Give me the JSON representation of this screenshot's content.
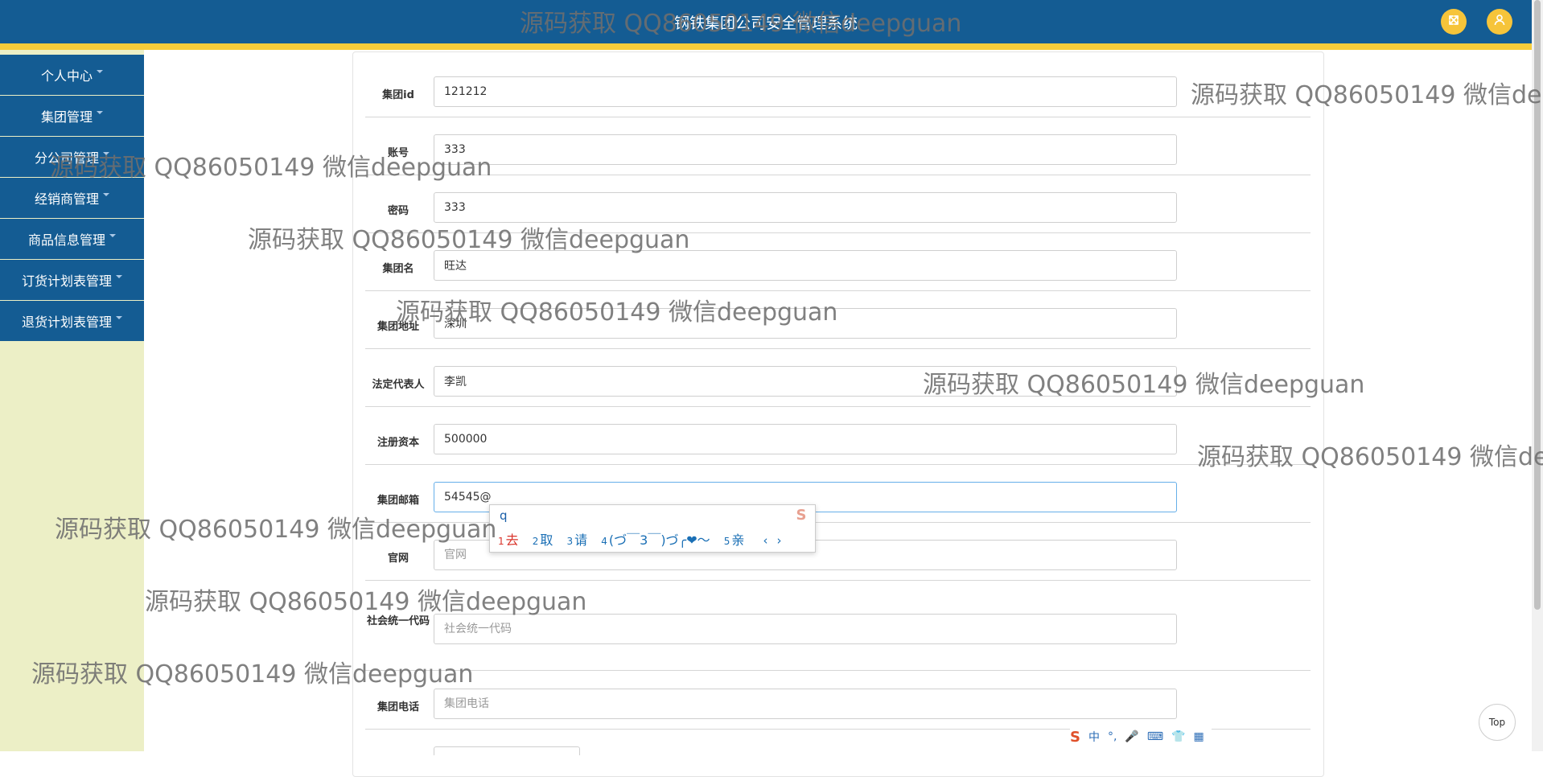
{
  "header": {
    "title": "钢铁集团公司安全管理系统"
  },
  "sidebar": {
    "items": [
      {
        "label": "个人中心"
      },
      {
        "label": "集团管理"
      },
      {
        "label": "分公司管理"
      },
      {
        "label": "经销商管理"
      },
      {
        "label": "商品信息管理"
      },
      {
        "label": "订货计划表管理"
      },
      {
        "label": "退货计划表管理"
      }
    ]
  },
  "form": {
    "fields": [
      {
        "label": "集团id",
        "value": "121212",
        "placeholder": ""
      },
      {
        "label": "账号",
        "value": "333",
        "placeholder": ""
      },
      {
        "label": "密码",
        "value": "333",
        "placeholder": ""
      },
      {
        "label": "集团名",
        "value": "旺达",
        "placeholder": ""
      },
      {
        "label": "集团地址",
        "value": "深圳",
        "placeholder": ""
      },
      {
        "label": "法定代表人",
        "value": "李凯",
        "placeholder": ""
      },
      {
        "label": "注册资本",
        "value": "500000",
        "placeholder": ""
      },
      {
        "label": "集团邮箱",
        "value": "54545@",
        "placeholder": ""
      },
      {
        "label": "官网",
        "value": "",
        "placeholder": "官网"
      },
      {
        "label": "社会统一代码",
        "value": "",
        "placeholder": "社会统一代码"
      },
      {
        "label": "集团电话",
        "value": "",
        "placeholder": "集团电话"
      }
    ]
  },
  "ime": {
    "typed": "q",
    "candidates": [
      {
        "num": "1",
        "text": "去"
      },
      {
        "num": "2",
        "text": "取"
      },
      {
        "num": "3",
        "text": "请"
      },
      {
        "num": "4",
        "text": "(づ￣3￣)づ╭❤～"
      },
      {
        "num": "5",
        "text": "亲"
      }
    ],
    "prev": "‹",
    "next": "›",
    "toolbar": {
      "logo": "S",
      "lang": "中",
      "punct": "°,",
      "mic": "🎤",
      "keyboard": "⌨",
      "skin": "👕",
      "tools": "▦"
    }
  },
  "top_button": {
    "label": "Top"
  },
  "watermark": {
    "text": "源码获取 QQ86050149 微信deepguan"
  },
  "colors": {
    "header_bg": "#145c93",
    "header_stripe": "#f6cc3a",
    "sidebar_bg": "#ecefc6",
    "accent": "#f6c43a"
  }
}
